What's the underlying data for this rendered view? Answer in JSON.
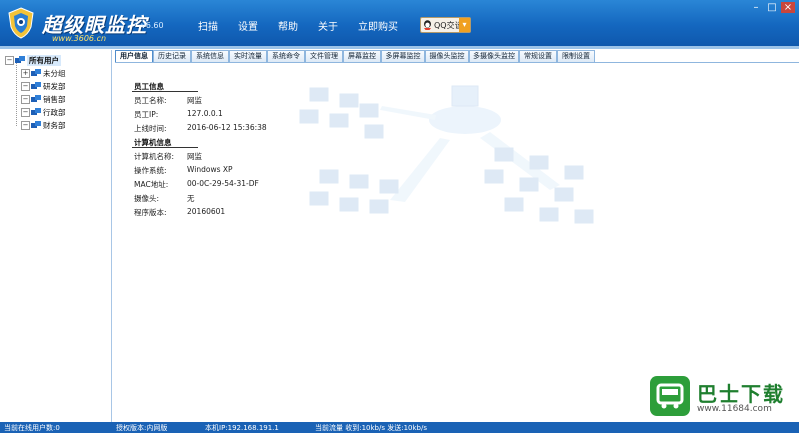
{
  "window": {
    "brand_title": "超级眼监控",
    "version": "v6.60",
    "url": "www.3606.cn",
    "menu": [
      "扫描",
      "设置",
      "帮助",
      "关于",
      "立即购买"
    ],
    "qq_label": "QQ交谈",
    "controls": [
      "–",
      "□",
      "×"
    ]
  },
  "tree": {
    "root": "所有用户",
    "groups": [
      "未分组",
      "研发部",
      "销售部",
      "行政部",
      "财务部"
    ]
  },
  "tabs": [
    "用户信息",
    "历史记录",
    "系统信息",
    "实时流量",
    "系统命令",
    "文件管理",
    "屏幕监控",
    "多屏幕监控",
    "摄像头监控",
    "多摄像头监控",
    "常规设置",
    "限制设置"
  ],
  "employee": {
    "section_title": "员工信息",
    "rows": [
      {
        "label": "员工名称:",
        "value": "网监"
      },
      {
        "label": "员工IP:",
        "value": "127.0.0.1"
      },
      {
        "label": "上线时间:",
        "value": "2016-06-12 15:36:38"
      }
    ]
  },
  "computer": {
    "section_title": "计算机信息",
    "rows": [
      {
        "label": "计算机名称:",
        "value": "网监"
      },
      {
        "label": "操作系统:",
        "value": "Windows XP"
      },
      {
        "label": "MAC地址:",
        "value": "00-0C-29-54-31-DF"
      },
      {
        "label": "摄像头:",
        "value": "无"
      },
      {
        "label": "程序版本:",
        "value": "20160601"
      }
    ]
  },
  "watermark": {
    "title": "巴士下载",
    "url": "www.11684.com"
  },
  "status": {
    "online": "当前在线用户数:0",
    "license": "授权版本:内网版",
    "local_ip": "本机IP:192.168.191.1",
    "traffic": "当前流量 收到:10kb/s   发送:10kb/s"
  }
}
